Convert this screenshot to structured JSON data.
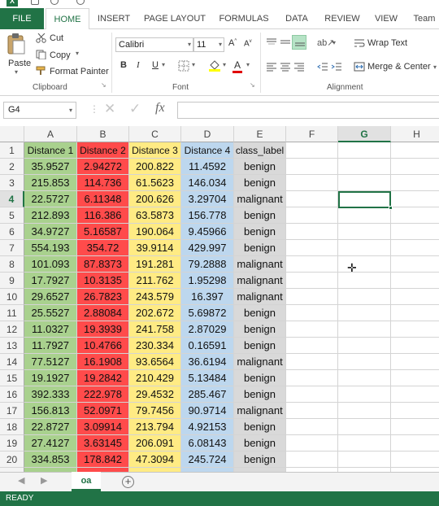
{
  "tabs": {
    "file": "FILE",
    "home": "HOME",
    "insert": "INSERT",
    "page_layout": "PAGE LAYOUT",
    "formulas": "FORMULAS",
    "data": "DATA",
    "review": "REVIEW",
    "view": "VIEW",
    "team": "Team"
  },
  "ribbon": {
    "paste": "Paste",
    "cut": "Cut",
    "copy": "Copy",
    "format_painter": "Format Painter",
    "clipboard_label": "Clipboard",
    "font_name": "Calibri",
    "font_size": "11",
    "bold": "B",
    "italic": "I",
    "underline": "U",
    "font_label": "Font",
    "wrap_text": "Wrap Text",
    "merge_center": "Merge & Center",
    "alignment_label": "Alignment"
  },
  "formula_bar": {
    "name_box": "G4",
    "fx": "fx",
    "value": ""
  },
  "columns": [
    "A",
    "B",
    "C",
    "D",
    "E",
    "F",
    "G",
    "H"
  ],
  "headers": [
    "Distance 1",
    "Distance 2",
    "Distance 3",
    "Distance 4",
    "class_label"
  ],
  "rows": [
    [
      "35.9527",
      "2.94272",
      "200.822",
      "11.4592",
      "benign"
    ],
    [
      "215.853",
      "114.736",
      "61.5623",
      "146.034",
      "benign"
    ],
    [
      "22.5727",
      "6.11348",
      "200.626",
      "3.29704",
      "malignant"
    ],
    [
      "212.893",
      "116.386",
      "63.5873",
      "156.778",
      "benign"
    ],
    [
      "34.9727",
      "5.16587",
      "190.064",
      "9.45966",
      "benign"
    ],
    [
      "554.193",
      "354.72",
      "39.9114",
      "429.997",
      "benign"
    ],
    [
      "101.093",
      "87.8373",
      "191.281",
      "79.2888",
      "malignant"
    ],
    [
      "17.7927",
      "10.3135",
      "211.762",
      "1.95298",
      "malignant"
    ],
    [
      "29.6527",
      "26.7823",
      "243.579",
      "16.397",
      "malignant"
    ],
    [
      "25.5527",
      "2.88084",
      "202.672",
      "5.69872",
      "benign"
    ],
    [
      "11.0327",
      "19.3939",
      "241.758",
      "2.87029",
      "benign"
    ],
    [
      "11.7927",
      "10.4766",
      "230.334",
      "0.16591",
      "benign"
    ],
    [
      "77.5127",
      "16.1908",
      "93.6564",
      "36.6194",
      "malignant"
    ],
    [
      "19.1927",
      "19.2842",
      "210.429",
      "5.13484",
      "benign"
    ],
    [
      "392.333",
      "222.978",
      "29.4532",
      "285.467",
      "benign"
    ],
    [
      "156.813",
      "52.0971",
      "79.7456",
      "90.9714",
      "malignant"
    ],
    [
      "22.8727",
      "3.09914",
      "213.794",
      "4.92153",
      "benign"
    ],
    [
      "27.4127",
      "3.63145",
      "206.091",
      "6.08143",
      "benign"
    ],
    [
      "334.853",
      "178.842",
      "47.3094",
      "245.724",
      "benign"
    ]
  ],
  "column_colors": [
    "#a9d18e",
    "#ff4b4b",
    "#ffeb84",
    "#bdd7ee",
    "#d9d9d9"
  ],
  "active_cell": {
    "column": "G",
    "row": 4
  },
  "sheet": {
    "name": "oa",
    "add_label": "+"
  },
  "status": "READY"
}
